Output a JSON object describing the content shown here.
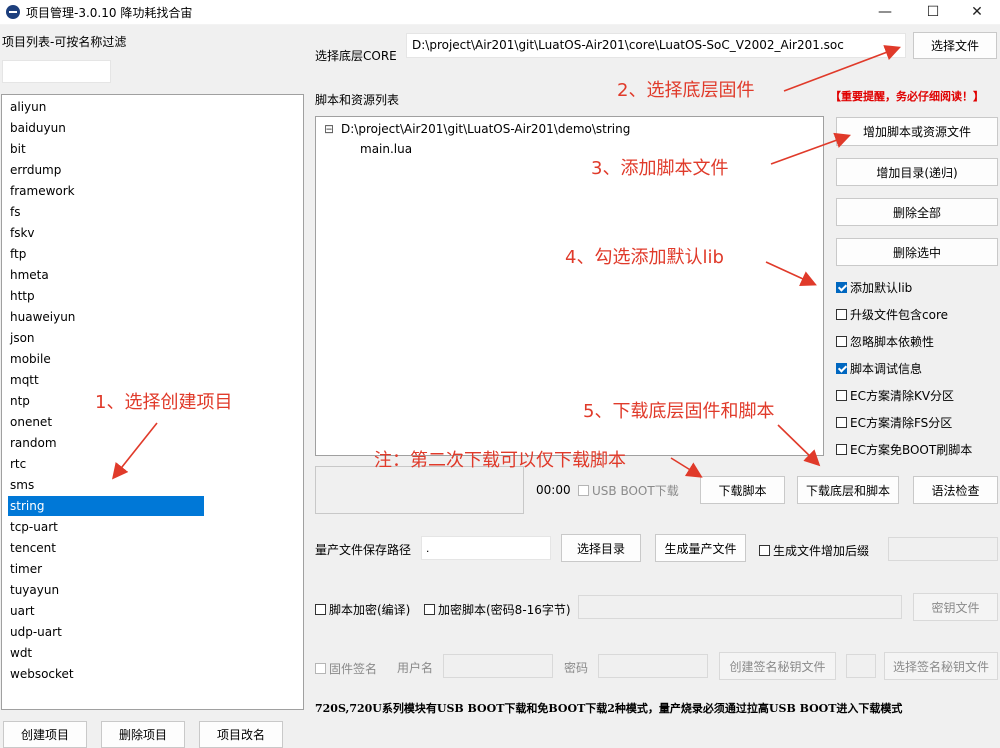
{
  "window": {
    "title": "项目管理-3.0.10 降功耗找合宙",
    "min": "—",
    "max": "☐",
    "close": "✕"
  },
  "projects": {
    "filter_label": "项目列表-可按名称过滤",
    "filter_value": "",
    "items": [
      "aliyun",
      "baiduyun",
      "bit",
      "errdump",
      "framework",
      "fs",
      "fskv",
      "ftp",
      "hmeta",
      "http",
      "huaweiyun",
      "json",
      "mobile",
      "mqtt",
      "ntp",
      "onenet",
      "random",
      "rtc",
      "sms",
      "string",
      "tcp-uart",
      "tencent",
      "timer",
      "tuyayun",
      "uart",
      "udp-uart",
      "wdt",
      "websocket"
    ],
    "selected": "string",
    "create": "创建项目",
    "delete": "删除项目",
    "rename": "项目改名"
  },
  "core": {
    "label": "选择底层CORE",
    "path": "D:\\project\\Air201\\git\\LuatOS-Air201\\core\\LuatOS-SoC_V2002_Air201.soc",
    "button": "选择文件"
  },
  "scripts": {
    "label": "脚本和资源列表",
    "warning": "【重要提醒，务必仔细阅读！】",
    "tree_root": "D:\\project\\Air201\\git\\LuatOS-Air201\\demo\\string",
    "tree_toggle": "⊟",
    "tree_child": "main.lua",
    "add_file": "增加脚本或资源文件",
    "add_dir": "增加目录(递归)",
    "delete_all": "删除全部",
    "delete_selected": "删除选中"
  },
  "options": [
    {
      "label": "添加默认lib",
      "checked": true
    },
    {
      "label": "升级文件包含core",
      "checked": false
    },
    {
      "label": "忽略脚本依赖性",
      "checked": false
    },
    {
      "label": "脚本调试信息",
      "checked": true
    },
    {
      "label": "EC方案清除KV分区",
      "checked": false
    },
    {
      "label": "EC方案清除FS分区",
      "checked": false
    },
    {
      "label": "EC方案免BOOT刷脚本",
      "checked": false
    }
  ],
  "download": {
    "timer": "00:00",
    "usb_boot": "USB BOOT下载",
    "download_script": "下载脚本",
    "download_all": "下载底层和脚本",
    "syntax_check": "语法检查"
  },
  "mass": {
    "path_label": "量产文件保存路径",
    "path_value": ".",
    "select_dir": "选择目录",
    "generate": "生成量产文件",
    "suffix": "生成文件增加后缀"
  },
  "encrypt": {
    "script_encrypt": "脚本加密(编译)",
    "encrypt_script": "加密脚本(密码8-16字节)",
    "key_file": "密钥文件"
  },
  "sign": {
    "firmware_sign": "固件签名",
    "username": "用户名",
    "password": "密码",
    "create_key": "创建签名秘钥文件",
    "select_key": "选择签名秘钥文件"
  },
  "footer": "720S,720U系列模块有USB BOOT下载和免BOOT下载2种模式，量产烧录必须通过拉高USB BOOT进入下载模式",
  "annotations": {
    "a1": "1、选择创建项目",
    "a2": "2、选择底层固件",
    "a3": "3、添加脚本文件",
    "a4": "4、勾选添加默认lib",
    "a5": "5、下载底层固件和脚本",
    "note": "注：第二次下载可以仅下载脚本"
  },
  "colors": {
    "accent": "#0078d7",
    "annotation": "#e03a2a",
    "warning": "#e00000"
  }
}
